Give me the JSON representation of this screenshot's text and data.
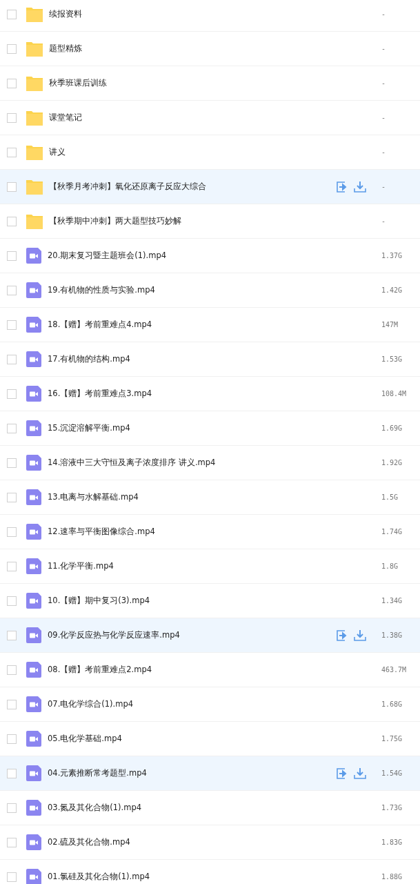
{
  "files": [
    {
      "kind": "folder",
      "name": "续报资料",
      "size": "-",
      "checked": false,
      "highlighted": false
    },
    {
      "kind": "folder",
      "name": "题型精炼",
      "size": "-",
      "checked": false,
      "highlighted": false
    },
    {
      "kind": "folder",
      "name": "秋季班课后训练",
      "size": "-",
      "checked": false,
      "highlighted": false
    },
    {
      "kind": "folder",
      "name": "课堂笔记",
      "size": "-",
      "checked": false,
      "highlighted": false
    },
    {
      "kind": "folder",
      "name": "讲义",
      "size": "-",
      "checked": false,
      "highlighted": false
    },
    {
      "kind": "folder",
      "name": "【秋季月考冲刺】氧化还原离子反应大综合",
      "size": "-",
      "checked": false,
      "highlighted": true
    },
    {
      "kind": "folder",
      "name": "【秋季期中冲刺】两大题型技巧妙解",
      "size": "-",
      "checked": false,
      "highlighted": false
    },
    {
      "kind": "video",
      "name": "20.期末复习暨主题班会(1).mp4",
      "size": "1.37G",
      "checked": false,
      "highlighted": false
    },
    {
      "kind": "video",
      "name": "19.有机物的性质与实验.mp4",
      "size": "1.42G",
      "checked": false,
      "highlighted": false
    },
    {
      "kind": "video",
      "name": "18.【赠】考前重难点4.mp4",
      "size": "147M",
      "checked": false,
      "highlighted": false
    },
    {
      "kind": "video",
      "name": "17.有机物的结构.mp4",
      "size": "1.53G",
      "checked": false,
      "highlighted": false
    },
    {
      "kind": "video",
      "name": "16.【赠】考前重难点3.mp4",
      "size": "108.4M",
      "checked": false,
      "highlighted": false
    },
    {
      "kind": "video",
      "name": "15.沉淀溶解平衡.mp4",
      "size": "1.69G",
      "checked": false,
      "highlighted": false
    },
    {
      "kind": "video",
      "name": "14.溶液中三大守恒及离子浓度排序 讲义.mp4",
      "size": "1.92G",
      "checked": false,
      "highlighted": false
    },
    {
      "kind": "video",
      "name": "13.电离与水解基础.mp4",
      "size": "1.5G",
      "checked": false,
      "highlighted": false
    },
    {
      "kind": "video",
      "name": "12.速率与平衡图像综合.mp4",
      "size": "1.74G",
      "checked": false,
      "highlighted": false
    },
    {
      "kind": "video",
      "name": "11.化学平衡.mp4",
      "size": "1.8G",
      "checked": false,
      "highlighted": false
    },
    {
      "kind": "video",
      "name": "10.【赠】期中复习(3).mp4",
      "size": "1.34G",
      "checked": false,
      "highlighted": false
    },
    {
      "kind": "video",
      "name": "09.化学反应热与化学反应速率.mp4",
      "size": "1.38G",
      "checked": false,
      "highlighted": true
    },
    {
      "kind": "video",
      "name": "08.【赠】考前重难点2.mp4",
      "size": "463.7M",
      "checked": false,
      "highlighted": false
    },
    {
      "kind": "video",
      "name": "07.电化学综合(1).mp4",
      "size": "1.68G",
      "checked": false,
      "highlighted": false
    },
    {
      "kind": "video",
      "name": "05.电化学基础.mp4",
      "size": "1.75G",
      "checked": false,
      "highlighted": false
    },
    {
      "kind": "video",
      "name": "04.元素推断常考题型.mp4",
      "size": "1.54G",
      "checked": false,
      "highlighted": true
    },
    {
      "kind": "video",
      "name": "03.氮及其化合物(1).mp4",
      "size": "1.73G",
      "checked": false,
      "highlighted": false
    },
    {
      "kind": "video",
      "name": "02.硫及其化合物.mp4",
      "size": "1.83G",
      "checked": false,
      "highlighted": false
    },
    {
      "kind": "video",
      "name": "01.氯硅及其化合物(1).mp4",
      "size": "1.88G",
      "checked": false,
      "highlighted": false
    }
  ]
}
